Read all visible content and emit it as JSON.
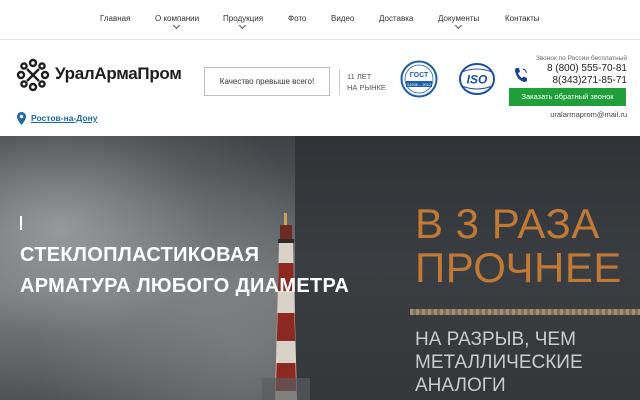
{
  "nav": {
    "items": [
      {
        "label": "Главная",
        "dropdown": false
      },
      {
        "label": "О компании",
        "dropdown": true
      },
      {
        "label": "Продукция",
        "dropdown": true
      },
      {
        "label": "Фото",
        "dropdown": false
      },
      {
        "label": "Видео",
        "dropdown": false
      },
      {
        "label": "Доставка",
        "dropdown": false
      },
      {
        "label": "Документы",
        "dropdown": true
      },
      {
        "label": "Контакты",
        "dropdown": false
      }
    ]
  },
  "header": {
    "logo_text": "УралАрмаПром",
    "city": "Ростов-на-Дону",
    "slogan": "Качество превыше всего!",
    "years_line1": "11 ЛЕТ",
    "years_line2": "НА РЫНКЕ",
    "gost_text": "ГОСТ",
    "gost_number": "31938 – 2012",
    "iso_text": "ISO",
    "phone_note": "Звонок по России бесплатный",
    "phone1": "8 (800) 555-70-81",
    "phone2": "8(343)271-85-71",
    "callback_label": "Заказать обратный звонок",
    "email": "uralarmaprom@mail.ru"
  },
  "hero": {
    "title_line1": "СТЕКЛОПЛАСТИКОВАЯ",
    "title_line2": "АРМАТУРА ЛЮБОГО ДИАМЕТРА",
    "banner_line1": "В 3 РАЗА",
    "banner_line2": "ПРОЧНЕЕ",
    "banner_sub1": "НА РАЗРЫВ, ЧЕМ",
    "banner_sub2": "МЕТАЛЛИЧЕСКИЕ",
    "banner_sub3": "АНАЛОГИ"
  },
  "colors": {
    "accent_green": "#1f9e3a",
    "link_blue": "#1a6aa8",
    "banner_orange": "#c07a36"
  }
}
